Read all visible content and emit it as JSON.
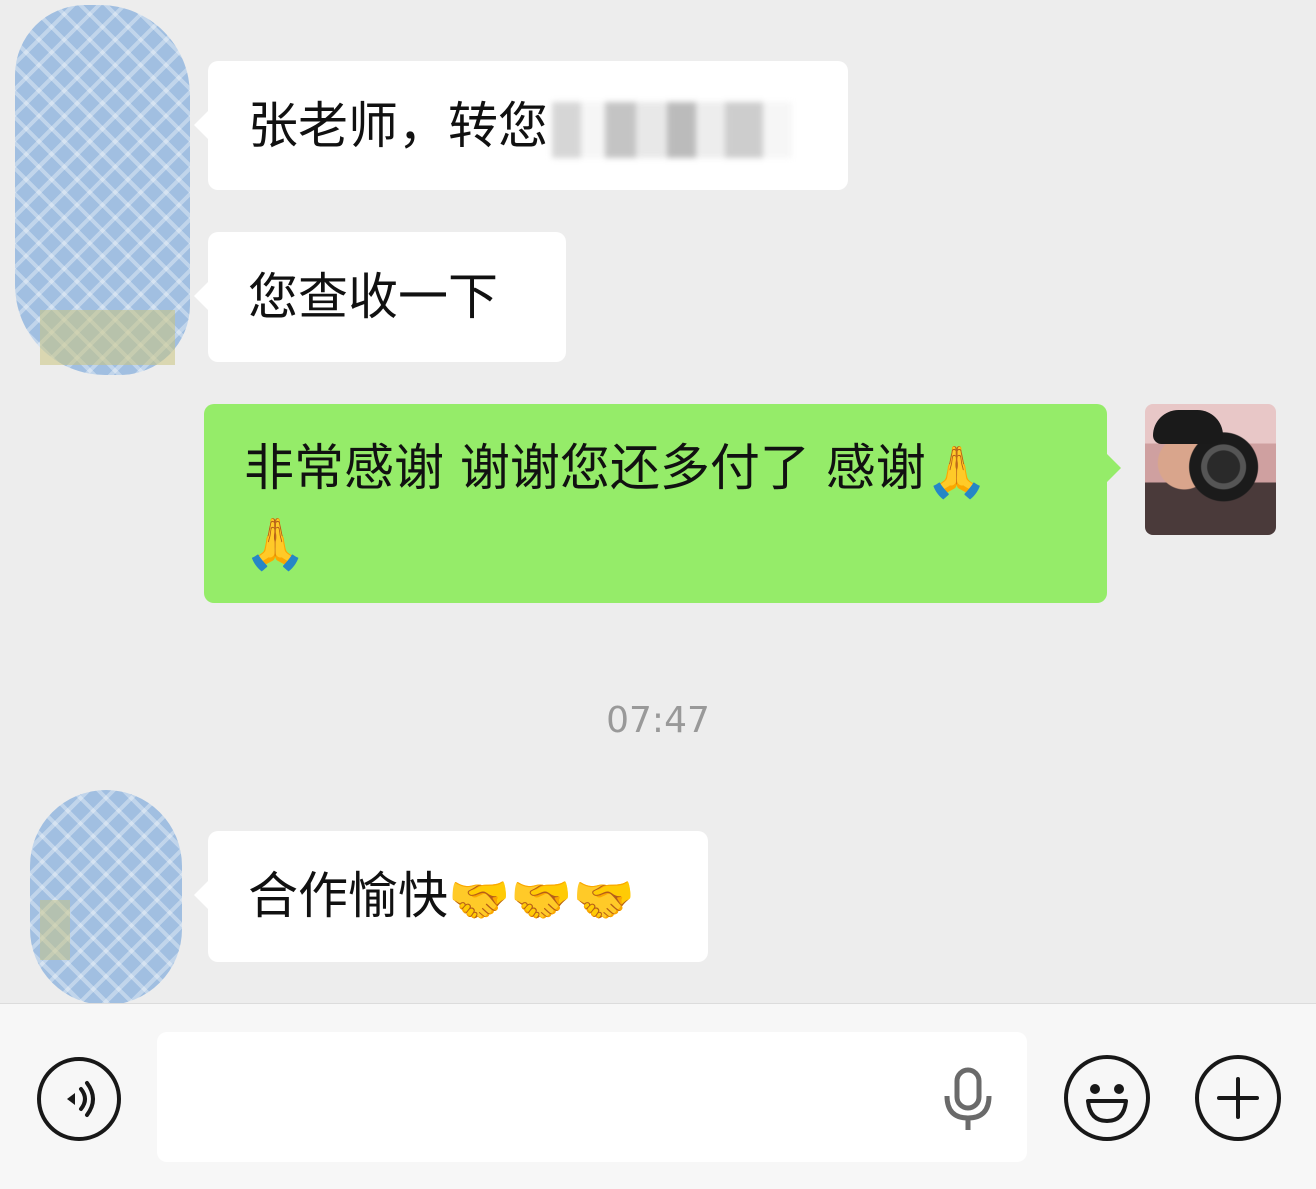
{
  "messages": [
    {
      "from": "other",
      "text": "张老师，转您"
    },
    {
      "from": "other",
      "text": "您查收一下"
    },
    {
      "from": "self",
      "text_line1": "非常感谢 谢谢您还多付了 感谢",
      "emoji_line1": "🙏",
      "emoji_line2": "🙏"
    },
    {
      "from": "other",
      "text": "合作愉快",
      "emojis": "🤝🤝🤝"
    }
  ],
  "timestamp": "07:47",
  "input": {
    "placeholder": ""
  },
  "icons": {
    "voice": "voice-icon",
    "mic": "microphone-icon",
    "emoji": "emoji-icon",
    "add": "plus-icon"
  },
  "colors": {
    "background": "#ededed",
    "self_bubble": "#95ec69",
    "other_bubble": "#ffffff",
    "avatar_blur": "#9dbde1",
    "timestamp": "#999999"
  }
}
